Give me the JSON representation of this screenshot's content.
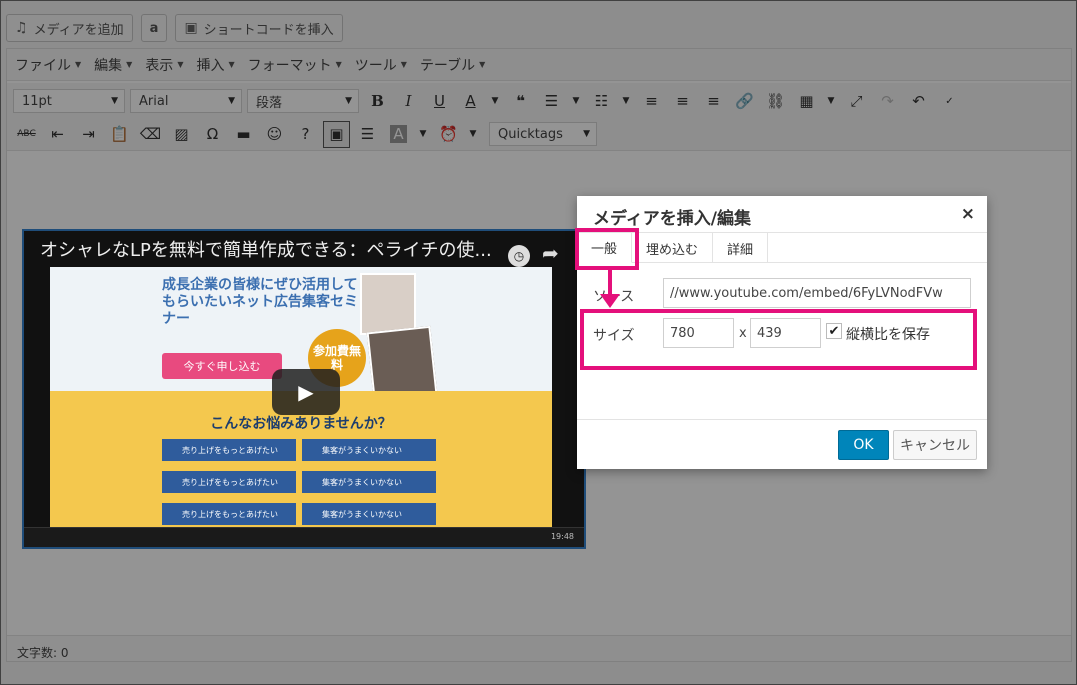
{
  "media_buttons": {
    "add_media": "メディアを追加",
    "amazon": "a",
    "shortcode": "ショートコードを挿入"
  },
  "menubar": [
    "ファイル",
    "編集",
    "表示",
    "挿入",
    "フォーマット",
    "ツール",
    "テーブル"
  ],
  "toolbar": {
    "font_size": "11pt",
    "font_family": "Arial",
    "block_format": "段落",
    "quicktags": "Quicktags"
  },
  "status_bar": {
    "word_count": "文字数: 0"
  },
  "video": {
    "title": "オシャレなLPを無料で簡単作成できる：ペライチの使...",
    "hero_heading": "成長企業の皆様にぜひ活用してもらいたいネット広告集客セミナー",
    "apply_button": "今すぐ申し込む",
    "badge": "参加費無料",
    "question": "こんなお悩みありませんか？",
    "checks": [
      "売り上げをもっとあげたい",
      "集客がうまくいかない",
      "売り上げをもっとあげたい",
      "集客がうまくいかない",
      "売り上げをもっとあげたい",
      "集客がうまくいかない"
    ],
    "taskbar_clock": "19:48"
  },
  "dialog": {
    "title": "メディアを挿入/編集",
    "close": "×",
    "tabs": [
      "一般",
      "埋め込む",
      "詳細"
    ],
    "source_label": "ソース",
    "source_value": "//www.youtube.com/embed/6FyLVNodFVw",
    "size_label": "サイズ",
    "width": "780",
    "x": "x",
    "height": "439",
    "constrain_label": "縦横比を保存",
    "constrain_checked": true,
    "ok": "OK",
    "cancel": "キャンセル"
  },
  "colors": {
    "highlight": "#e4107b",
    "primary_button": "#0085ba"
  }
}
